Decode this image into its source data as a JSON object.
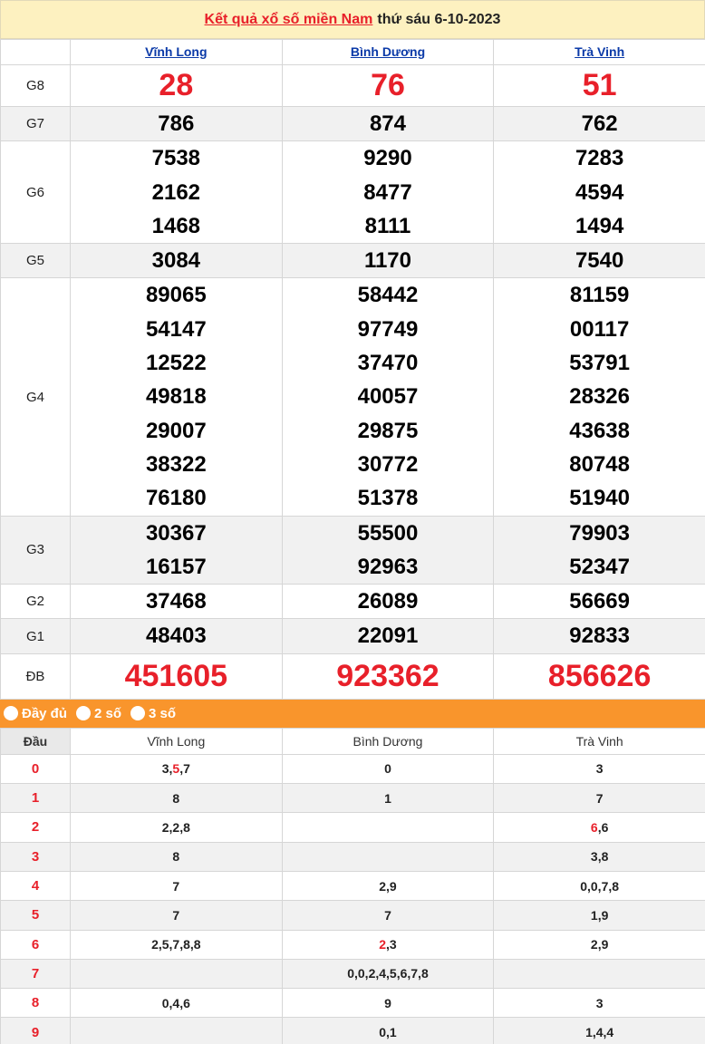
{
  "header": {
    "title_link": "Kết quả xổ số miền Nam",
    "title_date": "thứ sáu 6-10-2023"
  },
  "provinces": [
    "Vĩnh Long",
    "Bình Dương",
    "Trà Vinh"
  ],
  "prizes": [
    {
      "label": "G8",
      "values": [
        [
          "28"
        ],
        [
          "76"
        ],
        [
          "51"
        ]
      ]
    },
    {
      "label": "G7",
      "values": [
        [
          "786"
        ],
        [
          "874"
        ],
        [
          "762"
        ]
      ]
    },
    {
      "label": "G6",
      "values": [
        [
          "7538",
          "2162",
          "1468"
        ],
        [
          "9290",
          "8477",
          "8111"
        ],
        [
          "7283",
          "4594",
          "1494"
        ]
      ]
    },
    {
      "label": "G5",
      "values": [
        [
          "3084"
        ],
        [
          "1170"
        ],
        [
          "7540"
        ]
      ]
    },
    {
      "label": "G4",
      "values": [
        [
          "89065",
          "54147",
          "12522",
          "49818",
          "29007",
          "38322",
          "76180"
        ],
        [
          "58442",
          "97749",
          "37470",
          "40057",
          "29875",
          "30772",
          "51378"
        ],
        [
          "81159",
          "00117",
          "53791",
          "28326",
          "43638",
          "80748",
          "51940"
        ]
      ]
    },
    {
      "label": "G3",
      "values": [
        [
          "30367",
          "16157"
        ],
        [
          "55500",
          "92963"
        ],
        [
          "79903",
          "52347"
        ]
      ]
    },
    {
      "label": "G2",
      "values": [
        [
          "37468"
        ],
        [
          "26089"
        ],
        [
          "56669"
        ]
      ]
    },
    {
      "label": "G1",
      "values": [
        [
          "48403"
        ],
        [
          "22091"
        ],
        [
          "92833"
        ]
      ]
    },
    {
      "label": "ĐB",
      "values": [
        [
          "451605"
        ],
        [
          "923362"
        ],
        [
          "856626"
        ]
      ]
    }
  ],
  "toggles": [
    "Đầy đủ",
    "2 số",
    "3 số"
  ],
  "dau_table": {
    "header_first": "Đầu",
    "rows": [
      {
        "d": "0",
        "cells": [
          [
            {
              "t": "3,"
            },
            {
              "t": "5",
              "hl": true
            },
            {
              "t": ",7"
            }
          ],
          [
            {
              "t": "0"
            }
          ],
          [
            {
              "t": "3"
            }
          ]
        ]
      },
      {
        "d": "1",
        "cells": [
          [
            {
              "t": "8"
            }
          ],
          [
            {
              "t": "1"
            }
          ],
          [
            {
              "t": "7"
            }
          ]
        ]
      },
      {
        "d": "2",
        "cells": [
          [
            {
              "t": "2,2,8"
            }
          ],
          [],
          [
            {
              "t": "6",
              "hl": true
            },
            {
              "t": ",6"
            }
          ]
        ]
      },
      {
        "d": "3",
        "cells": [
          [
            {
              "t": "8"
            }
          ],
          [],
          [
            {
              "t": "3,8"
            }
          ]
        ]
      },
      {
        "d": "4",
        "cells": [
          [
            {
              "t": "7"
            }
          ],
          [
            {
              "t": "2,9"
            }
          ],
          [
            {
              "t": "0,0,7,8"
            }
          ]
        ]
      },
      {
        "d": "5",
        "cells": [
          [
            {
              "t": "7"
            }
          ],
          [
            {
              "t": "7"
            }
          ],
          [
            {
              "t": "1,9"
            }
          ]
        ]
      },
      {
        "d": "6",
        "cells": [
          [
            {
              "t": "2,5,7,8,8"
            }
          ],
          [
            {
              "t": "2",
              "hl": true
            },
            {
              "t": ",3"
            }
          ],
          [
            {
              "t": "2,9"
            }
          ]
        ]
      },
      {
        "d": "7",
        "cells": [
          [],
          [
            {
              "t": "0,0,2,4,5,6,7,8"
            }
          ],
          []
        ]
      },
      {
        "d": "8",
        "cells": [
          [
            {
              "t": "0,4,6"
            }
          ],
          [
            {
              "t": "9"
            }
          ],
          [
            {
              "t": "3"
            }
          ]
        ]
      },
      {
        "d": "9",
        "cells": [
          [],
          [
            {
              "t": "0,1"
            }
          ],
          [
            {
              "t": "1,4,4"
            }
          ]
        ]
      }
    ]
  },
  "colors": {
    "red": "#e8202a",
    "orange": "#f9952c",
    "title_bg": "#fdf1c0",
    "link_blue": "#0b3aa8"
  }
}
